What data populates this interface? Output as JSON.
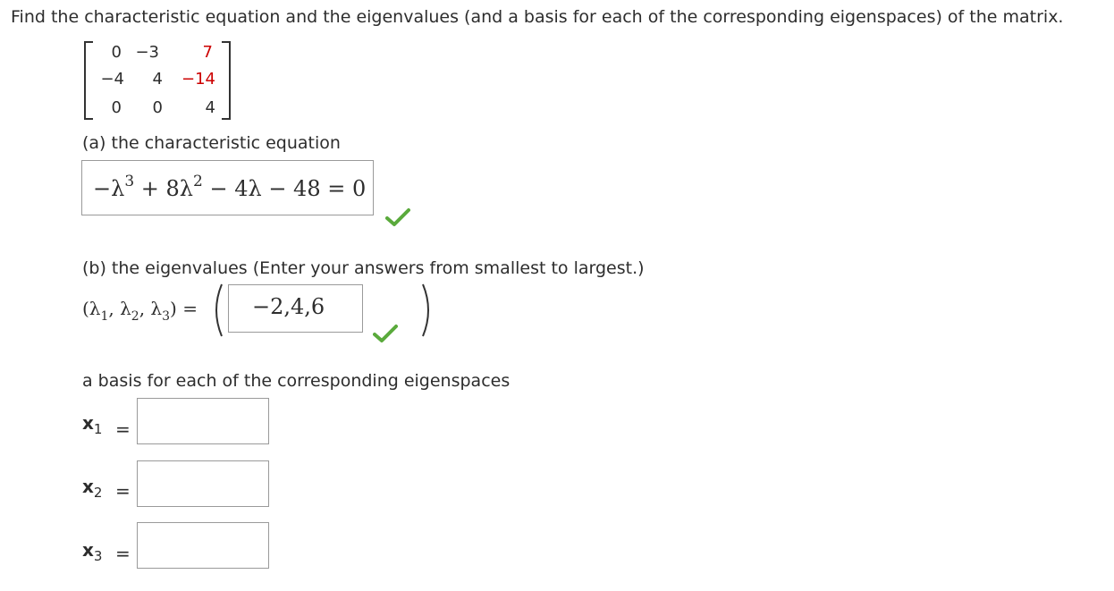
{
  "prompt": "Find the characteristic equation and the eigenvalues (and a basis for each of the corresponding eigenspaces) of the matrix.",
  "matrix": {
    "rows": [
      [
        "0",
        "−3",
        "7"
      ],
      [
        "−4",
        "4",
        "−14"
      ],
      [
        "0",
        "0",
        "4"
      ]
    ],
    "highlight_color": "#cc0000"
  },
  "part_a": {
    "label": "(a) the characteristic equation",
    "answer": {
      "t1": "−λ",
      "e1": "3",
      "t2": " + 8λ",
      "e2": "2",
      "t3": " − 4λ − 48 = 0"
    },
    "status_icon": "checkmark-icon",
    "status_color": "#5aaa3c"
  },
  "part_b": {
    "label": "(b) the eigenvalues (Enter your answers from smallest to largest.)",
    "lhs": {
      "open": "(λ",
      "s1": "1",
      "mid1": ", λ",
      "s2": "2",
      "mid2": ", λ",
      "s3": "3",
      "close": ") ="
    },
    "answer": "−2,4,6",
    "status_icon": "checkmark-icon"
  },
  "basis": {
    "label": "a basis for each of the corresponding eigenspaces",
    "vectors": [
      {
        "var": "x",
        "sub": "1",
        "eq": "=",
        "value": ""
      },
      {
        "var": "x",
        "sub": "2",
        "eq": "=",
        "value": ""
      },
      {
        "var": "x",
        "sub": "3",
        "eq": "=",
        "value": ""
      }
    ]
  }
}
